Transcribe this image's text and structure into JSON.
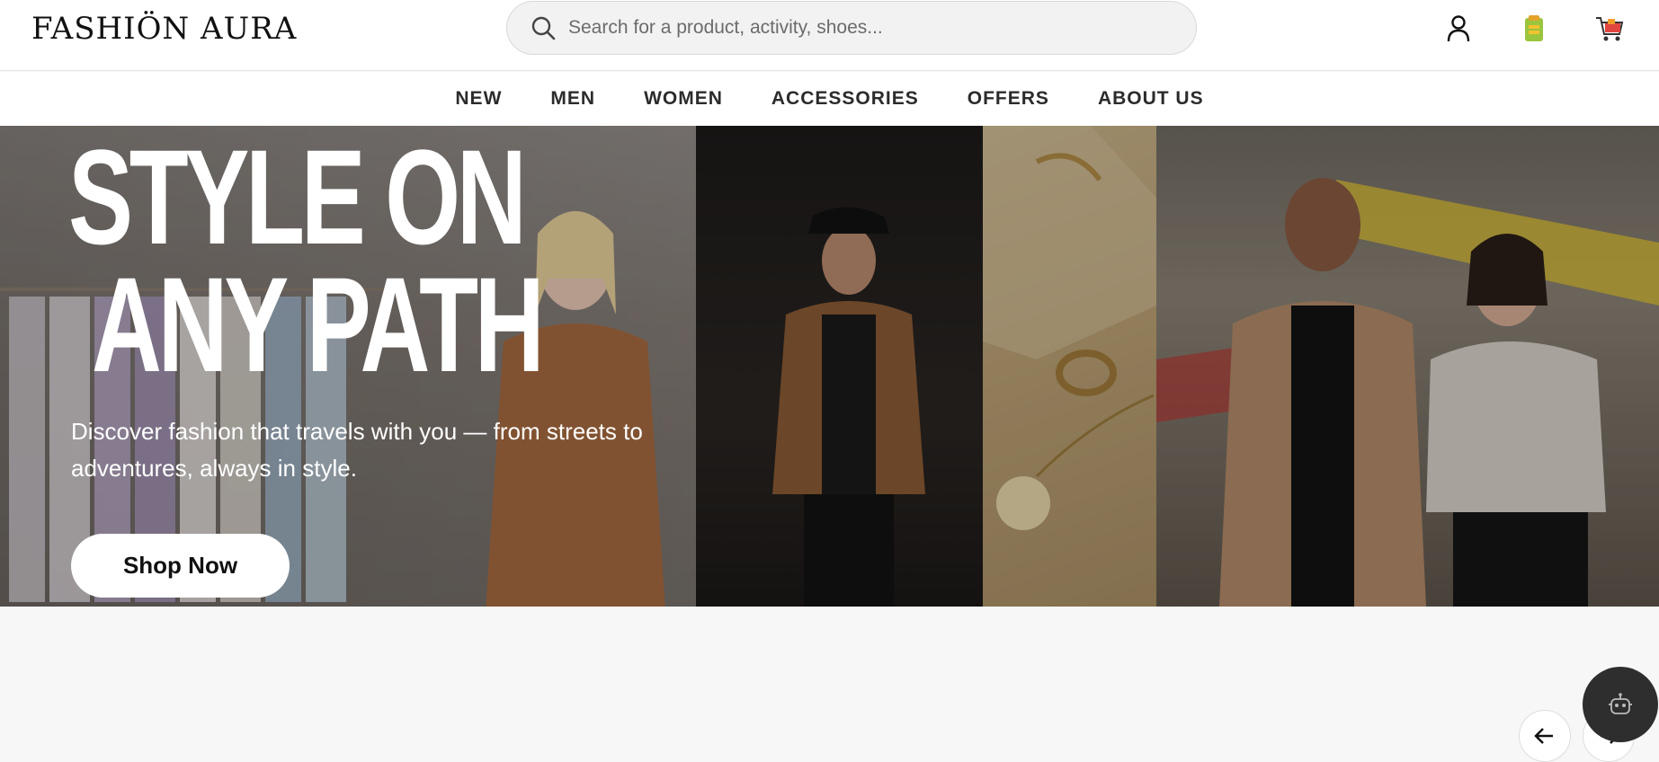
{
  "brand": {
    "logo_text": "FASHIÖN AURA"
  },
  "search": {
    "placeholder": "Search for a product, activity, shoes..."
  },
  "header_icons": [
    "user-icon",
    "wallet-icon",
    "cart-icon"
  ],
  "nav": {
    "items": [
      {
        "label": "NEW"
      },
      {
        "label": "MEN"
      },
      {
        "label": "WOMEN"
      },
      {
        "label": "ACCESSORIES"
      },
      {
        "label": "OFFERS"
      },
      {
        "label": "ABOUT US"
      }
    ]
  },
  "hero": {
    "title_line1": "STYLE ON",
    "title_line2": "ANY PATH",
    "subtitle": "Discover fashion that travels with you — from streets to adventures, always in style.",
    "cta_label": "Shop Now"
  },
  "colors": {
    "header_bg": "#ffffff",
    "page_bg": "#f7f7f7",
    "cta_bg": "#ffffff",
    "chat_bg": "#2e2e2e"
  }
}
